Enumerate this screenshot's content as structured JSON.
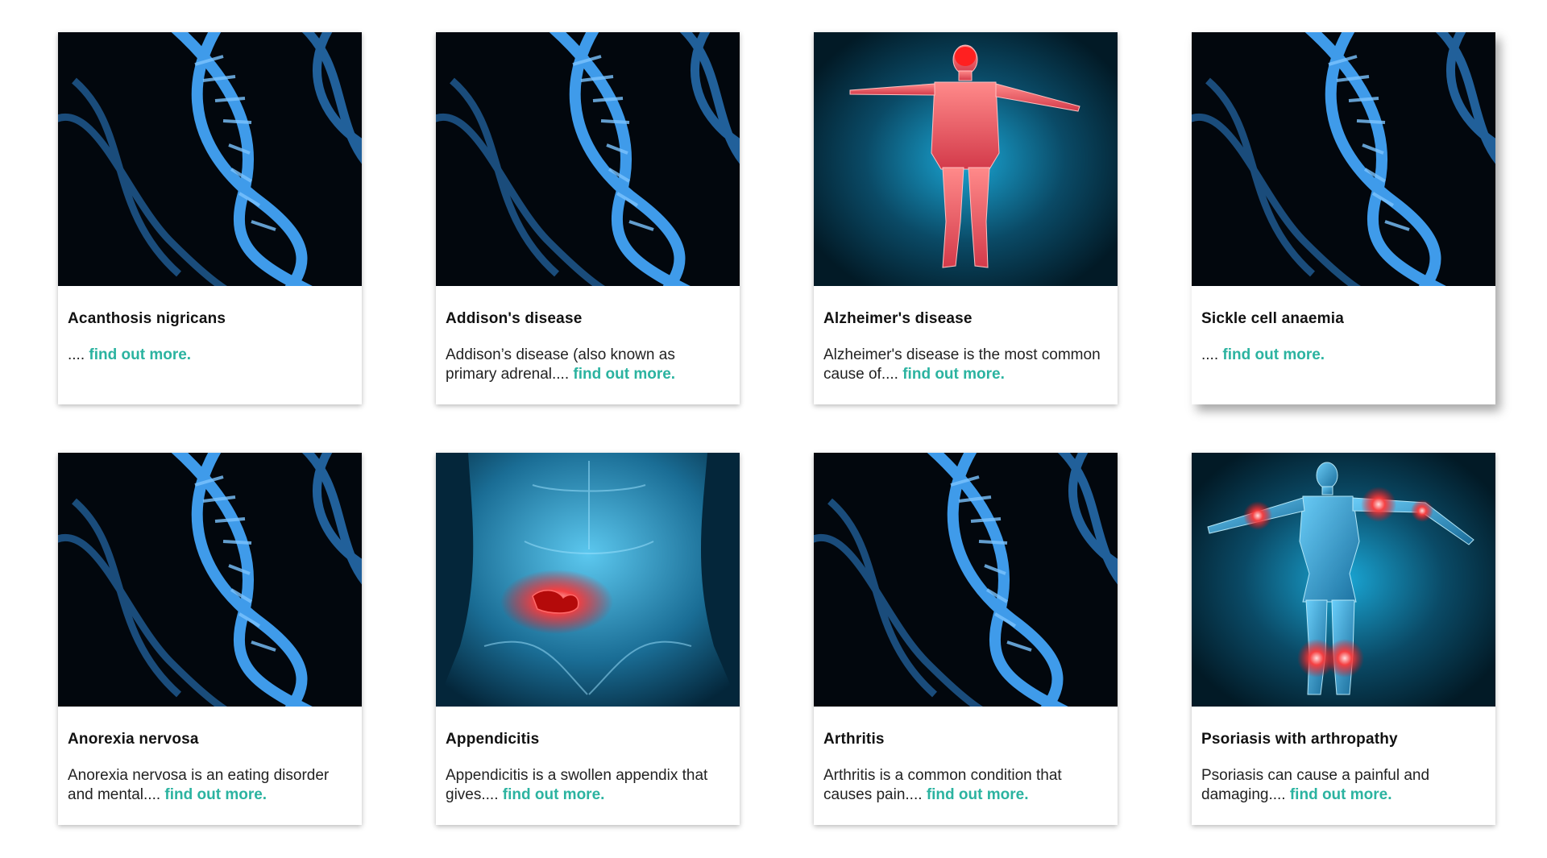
{
  "cards": [
    {
      "title": "Acanthosis nigricans",
      "excerpt": "....",
      "link": "find out more.",
      "image_icon": "dna-helix-image"
    },
    {
      "title": "Addison's disease",
      "excerpt": "Addison’s disease (also known as primary adrenal....",
      "link": "find out more.",
      "image_icon": "dna-helix-image"
    },
    {
      "title": "Alzheimer's disease",
      "excerpt": "Alzheimer's disease is the most common cause of....",
      "link": "find out more.",
      "image_icon": "human-body-brain-highlight-image"
    },
    {
      "title": "Sickle cell anaemia",
      "excerpt": "....",
      "link": "find out more.",
      "image_icon": "dna-helix-image"
    },
    {
      "title": "Anorexia nervosa",
      "excerpt": "Anorexia nervosa is an eating disorder and mental....",
      "link": "find out more.",
      "image_icon": "dna-helix-image"
    },
    {
      "title": "Appendicitis",
      "excerpt": "Appendicitis is a swollen appendix that gives....",
      "link": "find out more.",
      "image_icon": "abdomen-appendix-highlight-image"
    },
    {
      "title": "Arthritis",
      "excerpt": "Arthritis is a common condition that causes pain....",
      "link": "find out more.",
      "image_icon": "dna-helix-image"
    },
    {
      "title": "Psoriasis with arthropathy",
      "excerpt": "Psoriasis can cause a painful and damaging....",
      "link": "find out more.",
      "image_icon": "human-body-joints-highlight-image"
    }
  ],
  "colors": {
    "link": "#2bb3a0",
    "dna_blue": "#2f86d6",
    "image_bg": "#02070d",
    "highlight_red": "#ff3b3b"
  }
}
